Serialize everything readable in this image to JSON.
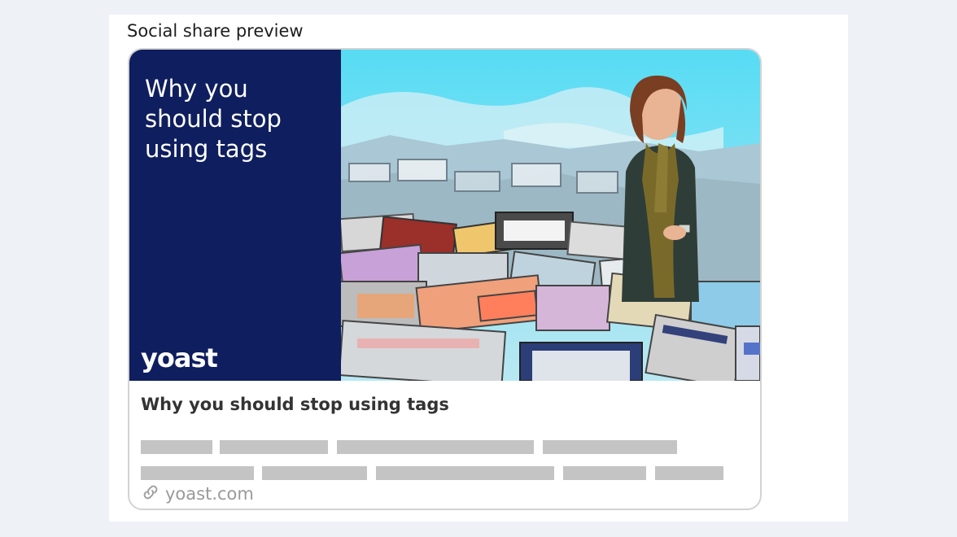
{
  "panel": {
    "title": "Social share preview"
  },
  "hero": {
    "headline": "Why you should stop using tags",
    "logo": "yoast"
  },
  "post": {
    "title": "Why you should stop using tags",
    "site": "yoast.com"
  },
  "icons": {
    "link": "link-icon"
  },
  "colors": {
    "hero_background": "#0f1e5e",
    "sky": "#5fd6ef",
    "skeleton": "#c4c4c4",
    "border": "#d3d3d3"
  }
}
